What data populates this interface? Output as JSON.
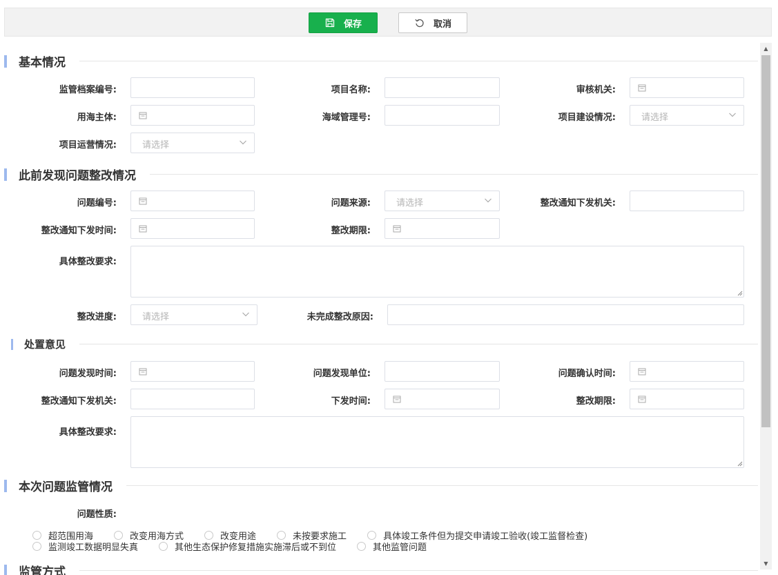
{
  "toolbar": {
    "save_label": "保存",
    "cancel_label": "取消"
  },
  "placeholder_select": "请选择",
  "sections": {
    "basic": "基本情况",
    "previous": "此前发现问题整改情况",
    "disposal": "处置意见",
    "current": "本次问题监管情况",
    "method": "监管方式"
  },
  "basic": {
    "archive_no": "监管档案编号:",
    "project_name": "项目名称:",
    "review_org": "审核机关:",
    "sea_user": "用海主体:",
    "sea_mgmt_no": "海域管理号:",
    "construction_status": "项目建设情况:",
    "operation_status": "项目运营情况:"
  },
  "previous": {
    "issue_no": "问题编号:",
    "issue_source": "问题来源:",
    "notice_org": "整改通知下发机关:",
    "notice_time": "整改通知下发时间:",
    "deadline": "整改期限:",
    "requirements": "具体整改要求:",
    "progress": "整改进度:",
    "incomplete_reason": "未完成整改原因:"
  },
  "disposal": {
    "found_time": "问题发现时间:",
    "found_unit": "问题发现单位:",
    "confirm_time": "问题确认时间:",
    "notice_org": "整改通知下发机关:",
    "issue_time": "下发时间:",
    "deadline": "整改期限:",
    "requirements": "具体整改要求:"
  },
  "current": {
    "nature_label": "问题性质:",
    "options_row1": [
      "超范围用海",
      "改变用海方式",
      "改变用途",
      "未按要求施工",
      "具体竣工条件但为提交申请竣工验收(竣工监督检查)"
    ],
    "options_row2": [
      "监测竣工数据明显失真",
      "其他生态保护修复措施实施滞后或不到位",
      "其他监管问题"
    ]
  }
}
